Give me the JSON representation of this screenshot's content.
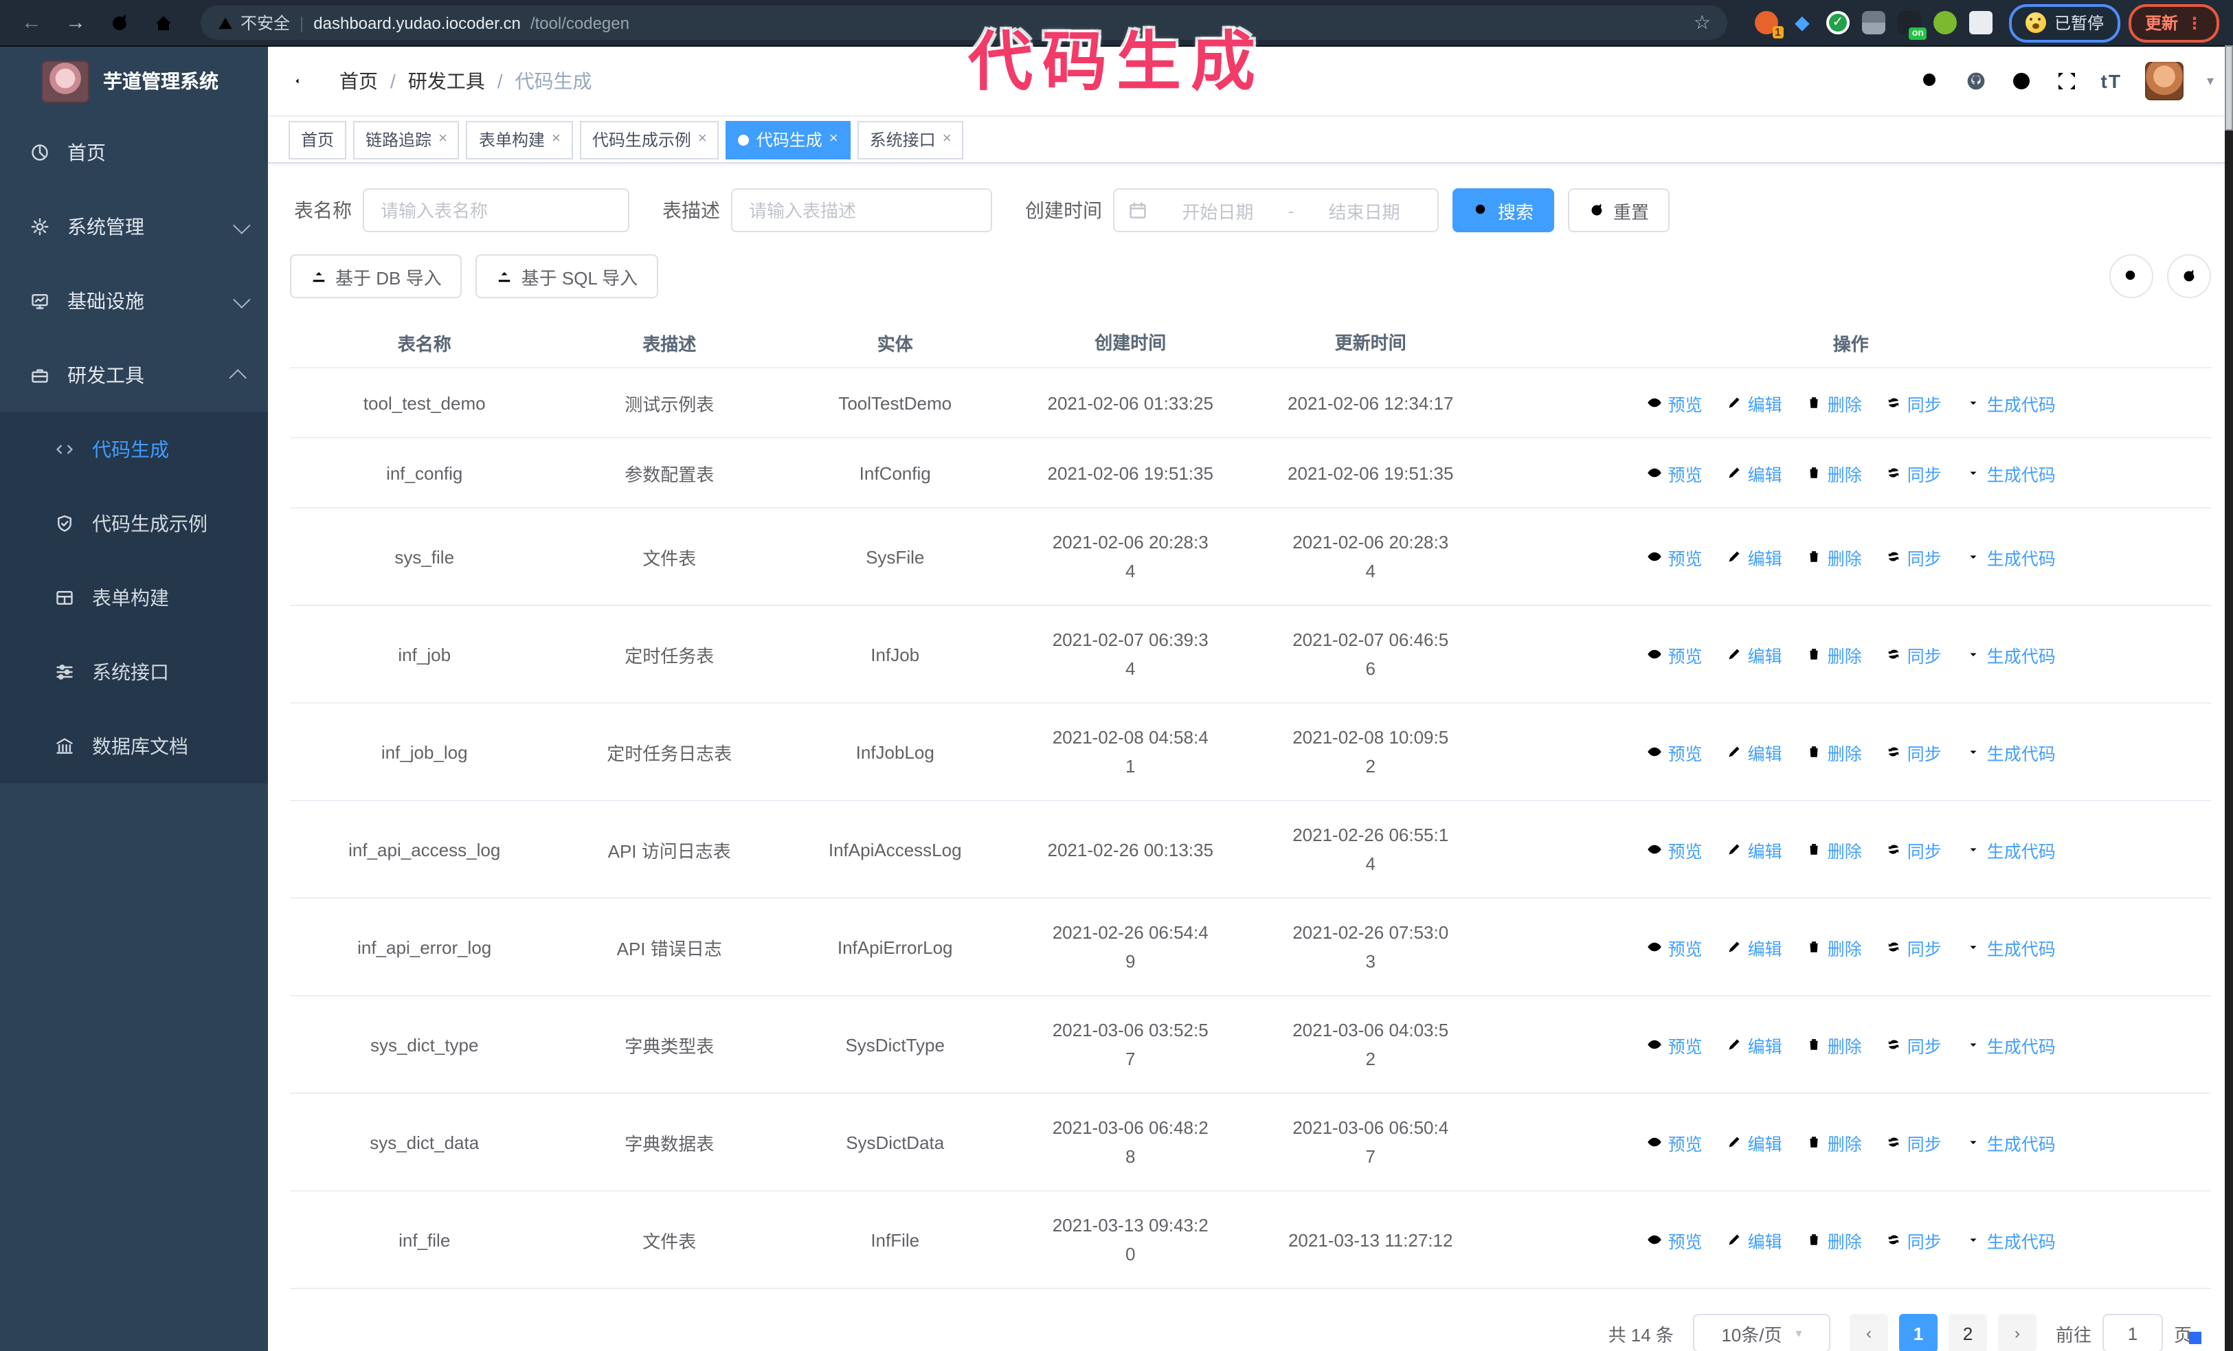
{
  "browser": {
    "security_label": "不安全",
    "url_host": "dashboard.yudao.iocoder.cn",
    "url_path": "/tool/codegen",
    "url_separator": "|",
    "paused_badge": "已暂停",
    "update_button": "更新"
  },
  "watermark": "代码生成",
  "sidebar": {
    "title": "芋道管理系统",
    "items": [
      {
        "label": "首页"
      },
      {
        "label": "系统管理"
      },
      {
        "label": "基础设施"
      },
      {
        "label": "研发工具"
      }
    ],
    "subitems": [
      {
        "label": "代码生成"
      },
      {
        "label": "代码生成示例"
      },
      {
        "label": "表单构建"
      },
      {
        "label": "系统接口"
      },
      {
        "label": "数据库文档"
      }
    ]
  },
  "breadcrumb": [
    "首页",
    "研发工具",
    "代码生成"
  ],
  "tabs": [
    {
      "label": "首页"
    },
    {
      "label": "链路追踪"
    },
    {
      "label": "表单构建"
    },
    {
      "label": "代码生成示例"
    },
    {
      "label": "代码生成"
    },
    {
      "label": "系统接口"
    }
  ],
  "search_form": {
    "table_name_label": "表名称",
    "table_name_placeholder": "请输入表名称",
    "table_desc_label": "表描述",
    "table_desc_placeholder": "请输入表描述",
    "create_time_label": "创建时间",
    "start_date_placeholder": "开始日期",
    "range_separator": "-",
    "end_date_placeholder": "结束日期",
    "search_button": "搜索",
    "reset_button": "重置"
  },
  "toolbar": {
    "import_db_button": "基于 DB 导入",
    "import_sql_button": "基于 SQL 导入"
  },
  "table": {
    "columns": [
      "表名称",
      "表描述",
      "实体",
      "创建时间",
      "更新时间",
      "操作"
    ],
    "actions": [
      "预览",
      "编辑",
      "删除",
      "同步",
      "生成代码"
    ],
    "rows": [
      {
        "name": "tool_test_demo",
        "desc": "测试示例表",
        "entity": "ToolTestDemo",
        "created": "2021-02-06 01:33:25",
        "updated": "2021-02-06 12:34:17"
      },
      {
        "name": "inf_config",
        "desc": "参数配置表",
        "entity": "InfConfig",
        "created": "2021-02-06 19:51:35",
        "updated": "2021-02-06 19:51:35"
      },
      {
        "name": "sys_file",
        "desc": "文件表",
        "entity": "SysFile",
        "created": "2021-02-06 20:28:3\n4",
        "updated": "2021-02-06 20:28:3\n4"
      },
      {
        "name": "inf_job",
        "desc": "定时任务表",
        "entity": "InfJob",
        "created": "2021-02-07 06:39:3\n4",
        "updated": "2021-02-07 06:46:5\n6"
      },
      {
        "name": "inf_job_log",
        "desc": "定时任务日志表",
        "entity": "InfJobLog",
        "created": "2021-02-08 04:58:4\n1",
        "updated": "2021-02-08 10:09:5\n2"
      },
      {
        "name": "inf_api_access_log",
        "desc": "API 访问日志表",
        "entity": "InfApiAccessLog",
        "created": "2021-02-26 00:13:35",
        "updated": "2021-02-26 06:55:1\n4"
      },
      {
        "name": "inf_api_error_log",
        "desc": "API 错误日志",
        "entity": "InfApiErrorLog",
        "created": "2021-02-26 06:54:4\n9",
        "updated": "2021-02-26 07:53:0\n3"
      },
      {
        "name": "sys_dict_type",
        "desc": "字典类型表",
        "entity": "SysDictType",
        "created": "2021-03-06 03:52:5\n7",
        "updated": "2021-03-06 04:03:5\n2"
      },
      {
        "name": "sys_dict_data",
        "desc": "字典数据表",
        "entity": "SysDictData",
        "created": "2021-03-06 06:48:2\n8",
        "updated": "2021-03-06 06:50:4\n7"
      },
      {
        "name": "inf_file",
        "desc": "文件表",
        "entity": "InfFile",
        "created": "2021-03-13 09:43:2\n0",
        "updated": "2021-03-13 11:27:12"
      }
    ]
  },
  "pagination": {
    "total_text": "共 14 条",
    "page_size": "10条/页",
    "pages": [
      "1",
      "2"
    ],
    "goto_label": "前往",
    "goto_value": "1",
    "goto_suffix": "页"
  }
}
